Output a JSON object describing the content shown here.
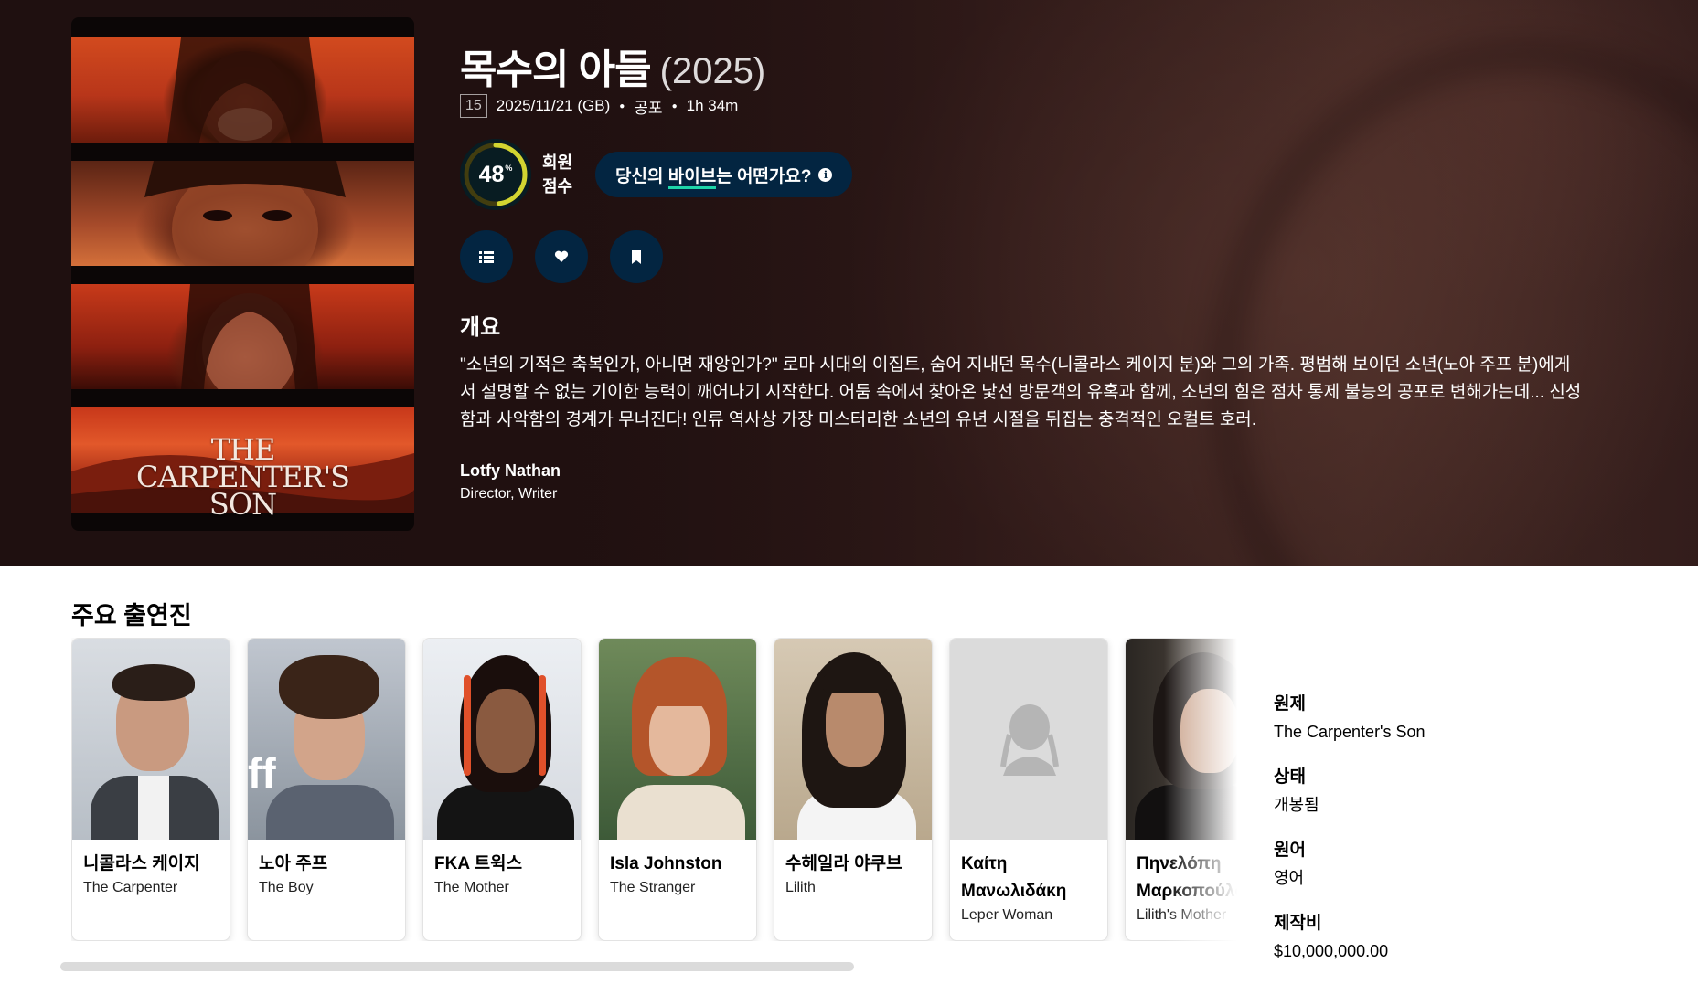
{
  "movie": {
    "title": "목수의 아들",
    "year": "(2025)",
    "certification": "15",
    "release": "2025/11/21 (GB)",
    "genre": "공포",
    "runtime": "1h 34m",
    "poster_text": [
      "THE",
      "CARPENTER'S",
      "SON"
    ]
  },
  "score": {
    "value": "48",
    "percent_sign": "%",
    "fraction": 0.48,
    "label_line1": "회원",
    "label_line2": "점수",
    "ring_color": "#d2d531",
    "track_color": "#423d0f"
  },
  "vibe": {
    "prefix": "당신의 ",
    "highlight": "바이브",
    "suffix": "는 어떤가요?",
    "info_glyph": "i"
  },
  "actions": [
    {
      "name": "add-to-list",
      "icon": "list-icon"
    },
    {
      "name": "favorite",
      "icon": "heart-icon"
    },
    {
      "name": "watchlist",
      "icon": "bookmark-icon"
    }
  ],
  "overview": {
    "heading": "개요",
    "text": "\"소년의 기적은 축복인가, 아니면 재앙인가?\" 로마 시대의 이집트, 숨어 지내던 목수(니콜라스 케이지 분)와 그의 가족. 평범해 보이던 소년(노아 주프 분)에게서 설명할 수 없는 기이한 능력이 깨어나기 시작한다. 어둠 속에서 찾아온 낯선 방문객의 유혹과 함께, 소년의 힘은 점차 통제 불능의 공포로 변해가는데... 신성함과 사악함의 경계가 무너진다! 인류 역사상 가장 미스터리한 소년의 유년 시절을 뒤집는 충격적인 오컬트 호러."
  },
  "crew": {
    "name": "Lotfy Nathan",
    "job": "Director, Writer"
  },
  "cast": {
    "heading": "주요 출연진",
    "members": [
      {
        "name": "니콜라스 케이지",
        "character": "The Carpenter"
      },
      {
        "name": "노아 주프",
        "character": "The Boy"
      },
      {
        "name": "FKA 트윅스",
        "character": "The Mother"
      },
      {
        "name": "Isla Johnston",
        "character": "The Stranger"
      },
      {
        "name": "수헤일라 야쿠브",
        "character": "Lilith"
      },
      {
        "name": "Καίτη Μανωλιδάκη",
        "character": "Leper Woman"
      },
      {
        "name": "Πηνελόπη Μαρκοπούλου",
        "character": "Lilith's Mother"
      }
    ]
  },
  "facts": [
    {
      "label": "원제",
      "value": "The Carpenter's Son"
    },
    {
      "label": "상태",
      "value": "개봉됨"
    },
    {
      "label": "원어",
      "value": "영어"
    },
    {
      "label": "제작비",
      "value": "$10,000,000.00"
    }
  ],
  "colors": {
    "accent_dark_blue": "#032541",
    "vibe_underline": "#1ed5a9"
  }
}
